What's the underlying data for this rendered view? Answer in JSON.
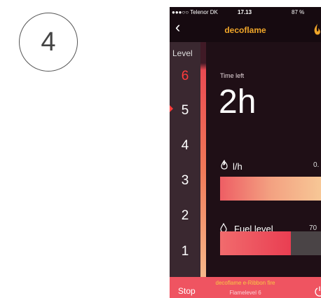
{
  "step": {
    "number": "4"
  },
  "status_bar": {
    "carrier": "●●●○○ Telenor DK",
    "time": "17.13",
    "battery": "87 %"
  },
  "nav": {
    "title": "decoflame"
  },
  "level": {
    "header": "Level",
    "items": [
      "6",
      "5",
      "4",
      "3",
      "2",
      "1"
    ],
    "active": "6"
  },
  "time_left": {
    "label": "Time left",
    "value": "2h"
  },
  "consumption": {
    "label": "l/h",
    "value": "0."
  },
  "fuel": {
    "label": "Fuel level",
    "value": "70",
    "fill": 0.7
  },
  "bottom": {
    "stop_label": "Stop",
    "device_name": "decoflame e-Ribbon fire",
    "flame_level": "Flamelevel 6"
  },
  "colors": {
    "accent": "#f0a629",
    "active_level": "#ff3c3c",
    "bottom_bar": "#ef5461"
  }
}
